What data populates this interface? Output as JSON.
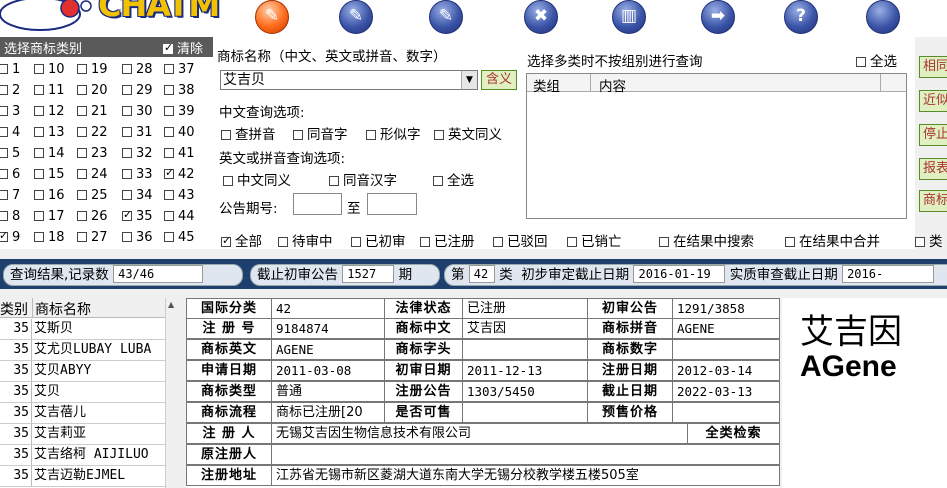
{
  "app": {
    "logo_text": "CHATM"
  },
  "toolbar": {
    "buttons": [
      {
        "name": "query",
        "glyph": "✎"
      },
      {
        "name": "edit",
        "glyph": "✎"
      },
      {
        "name": "write",
        "glyph": "✎"
      },
      {
        "name": "tools",
        "glyph": "✖"
      },
      {
        "name": "bank",
        "glyph": "▥"
      },
      {
        "name": "next",
        "glyph": "➡"
      },
      {
        "name": "help",
        "glyph": "?"
      },
      {
        "name": "more",
        "glyph": ""
      }
    ]
  },
  "category_panel": {
    "title": "选择商标类别",
    "clear_label": "清除",
    "checked": [
      "9",
      "35",
      "42"
    ],
    "columns": [
      [
        "1",
        "2",
        "3",
        "4",
        "5",
        "6",
        "7",
        "8",
        "9"
      ],
      [
        "10",
        "11",
        "12",
        "13",
        "14",
        "15",
        "16",
        "17",
        "18"
      ],
      [
        "19",
        "20",
        "21",
        "22",
        "23",
        "24",
        "25",
        "26",
        "27"
      ],
      [
        "28",
        "29",
        "30",
        "31",
        "32",
        "33",
        "34",
        "35",
        "36"
      ],
      [
        "37",
        "38",
        "39",
        "40",
        "41",
        "42",
        "43",
        "44",
        "45"
      ]
    ]
  },
  "search": {
    "name_label": "商标名称（中文、英文或拼音、数字）",
    "name_value": "艾吉贝",
    "contains_button": "含义",
    "chinese_options_label": "中文查询选项:",
    "chinese_options": [
      "查拼音",
      "同音字",
      "形似字",
      "英文同义"
    ],
    "english_options_label": "英文或拼音查询选项:",
    "english_options": [
      "中文同义",
      "同音汉字",
      "全选"
    ],
    "announce_label": "公告期号:",
    "to_label": "至"
  },
  "groups": {
    "title": "选择多类时不按组别进行查询",
    "select_all": "全选",
    "col_group": "类组",
    "col_content": "内容"
  },
  "side_buttons": [
    "相同",
    "近似",
    "停止",
    "报表",
    "商标"
  ],
  "status_filters": [
    "全部",
    "待审中",
    "已初审",
    "已注册",
    "已驳回",
    "已销亡",
    "在结果中搜索",
    "在结果中合并",
    "类"
  ],
  "info_bar": {
    "results_label": "查询结果,记录数",
    "results_count": "43/46",
    "deadline_label": "截止初审公告",
    "deadline_value": "1527",
    "deadline_unit": "期",
    "issue_prefix": "第",
    "issue_class": "42",
    "issue_suffix": "类",
    "prelim_label": "初步审定截止日期",
    "prelim_date": "2016-01-19",
    "exam_label": "实质审查截止日期",
    "exam_date": "2016-"
  },
  "results": {
    "col_class": "类别",
    "col_name": "商标名称",
    "rows": [
      {
        "cls": "35",
        "name": "艾斯贝"
      },
      {
        "cls": "35",
        "name": "艾尤贝LUBAY LUBA"
      },
      {
        "cls": "35",
        "name": "艾贝ABYY"
      },
      {
        "cls": "35",
        "name": "艾贝"
      },
      {
        "cls": "35",
        "name": "艾吉蓓儿"
      },
      {
        "cls": "35",
        "name": "艾吉莉亚"
      },
      {
        "cls": "35",
        "name": "艾吉络柯 AIJILUO"
      },
      {
        "cls": "35",
        "name": "艾吉迈勒EJMEL"
      }
    ]
  },
  "detail": {
    "intl_class_k": "国际分类",
    "intl_class_v": "42",
    "legal_k": "法律状态",
    "legal_v": "已注册",
    "first_ann_k": "初审公告",
    "first_ann_v": "1291/3858",
    "reg_no_k": "注 册 号",
    "reg_no_v": "9184874",
    "cn_k": "商标中文",
    "cn_v": "艾吉因",
    "pinyin_k": "商标拼音",
    "pinyin_v": "AGENE",
    "en_k": "商标英文",
    "en_v": "AGENE",
    "head_k": "商标字头",
    "head_v": "",
    "digit_k": "商标数字",
    "digit_v": "",
    "apply_k": "申请日期",
    "apply_v": "2011-03-08",
    "first_date_k": "初审日期",
    "first_date_v": "2011-12-13",
    "reg_date_k": "注册日期",
    "reg_date_v": "2012-03-14",
    "type_k": "商标类型",
    "type_v": "普通",
    "reg_ann_k": "注册公告",
    "reg_ann_v": "1303/5450",
    "end_k": "截止日期",
    "end_v": "2022-03-13",
    "flow_k": "商标流程",
    "flow_v": "商标已注册[20",
    "sale_k": "是否可售",
    "sale_v": "",
    "price_k": "预售价格",
    "price_v": "",
    "owner_k": "注 册 人",
    "owner_v": "无锡艾吉因生物信息技术有限公司",
    "all_search": "全类检索",
    "orig_owner_k": "原注册人",
    "orig_owner_v": "",
    "addr_k": "注册地址",
    "addr_v": "江苏省无锡市新区菱湖大道东南大学无锡分校教学楼五楼505室"
  },
  "preview": {
    "cn": "艾吉因",
    "en": "AGene"
  }
}
